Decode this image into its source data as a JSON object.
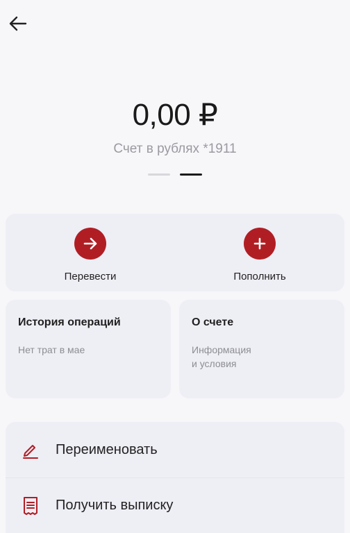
{
  "header": {
    "back_icon": "arrow-left-icon"
  },
  "account": {
    "balance": "0,00 ₽",
    "subtitle": "Счет в рублях *1911",
    "pager_total": 2,
    "pager_active": 2
  },
  "actions": [
    {
      "label": "Перевести",
      "icon": "arrow-right-icon"
    },
    {
      "label": "Пополнить",
      "icon": "plus-icon"
    }
  ],
  "cards": {
    "history": {
      "title": "История операций",
      "subtitle": "Нет трат в мае"
    },
    "about": {
      "title": "О счете",
      "subtitle": "Информация\nи условия"
    }
  },
  "menu": [
    {
      "label": "Переименовать",
      "icon": "pencil-icon"
    },
    {
      "label": "Получить выписку",
      "icon": "receipt-icon"
    }
  ],
  "colors": {
    "accent": "#b01e24",
    "background": "#f7f7fa",
    "card": "#eeeef5"
  }
}
